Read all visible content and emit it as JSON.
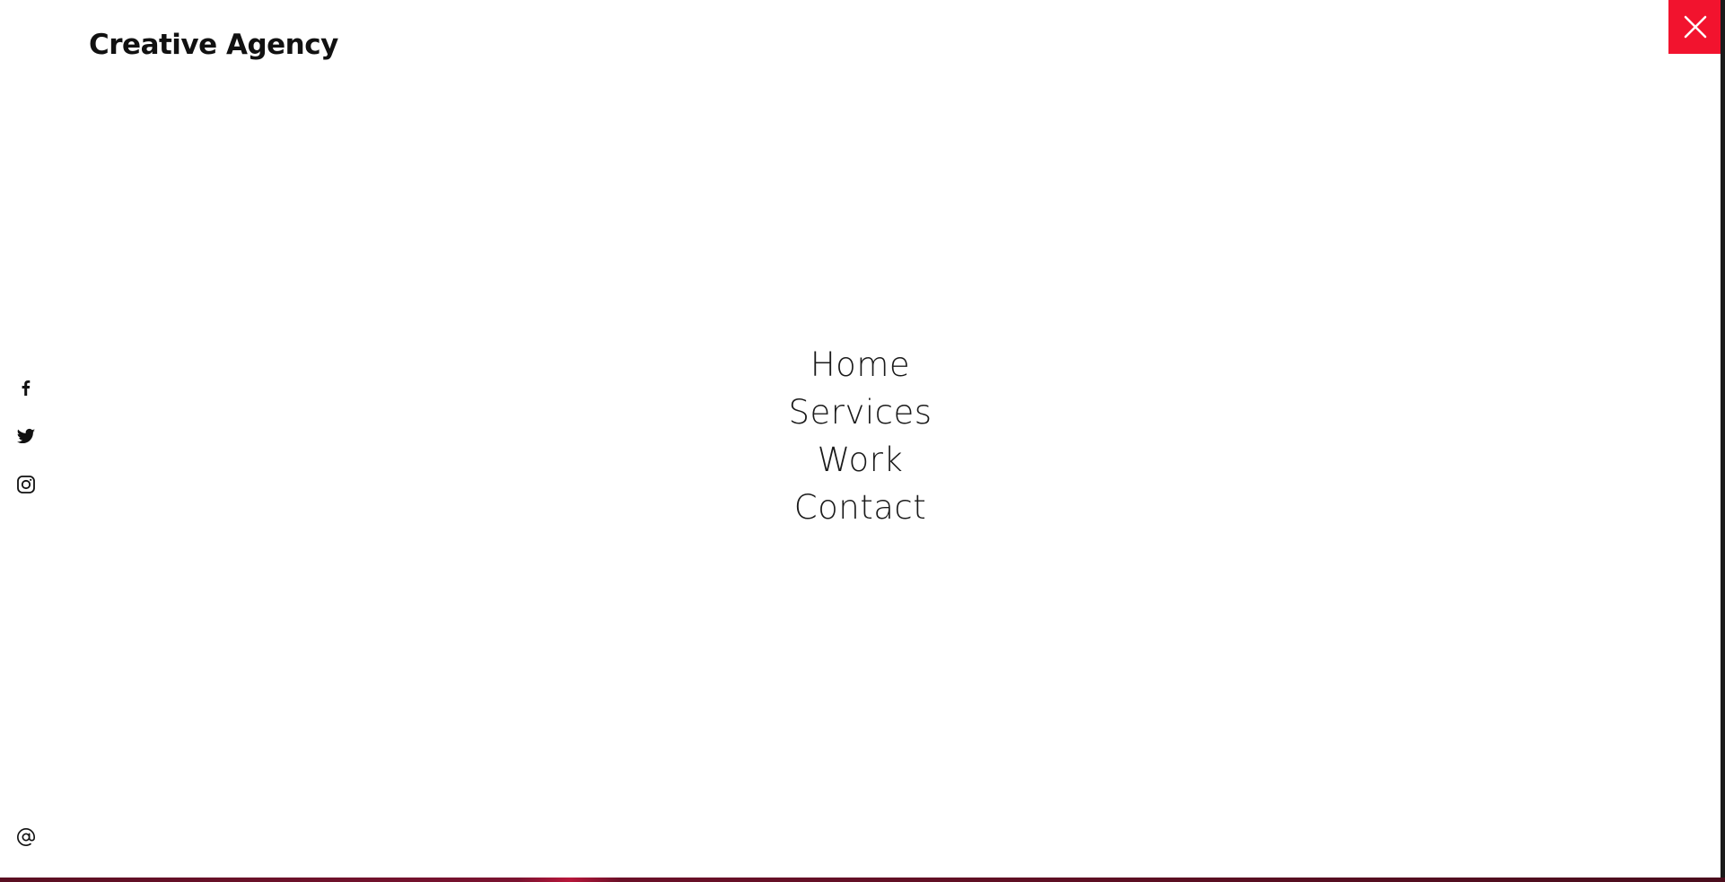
{
  "brand": {
    "name": "Creative Agency"
  },
  "close": {
    "icon": "close-icon",
    "color": "#f2132e"
  },
  "nav": {
    "items": [
      {
        "label": "Home"
      },
      {
        "label": "Services"
      },
      {
        "label": "Work"
      },
      {
        "label": "Contact"
      }
    ]
  },
  "social": {
    "items": [
      {
        "icon": "facebook-icon"
      },
      {
        "icon": "twitter-icon"
      },
      {
        "icon": "instagram-icon"
      }
    ]
  },
  "contact": {
    "icon": "at-sign-icon"
  }
}
